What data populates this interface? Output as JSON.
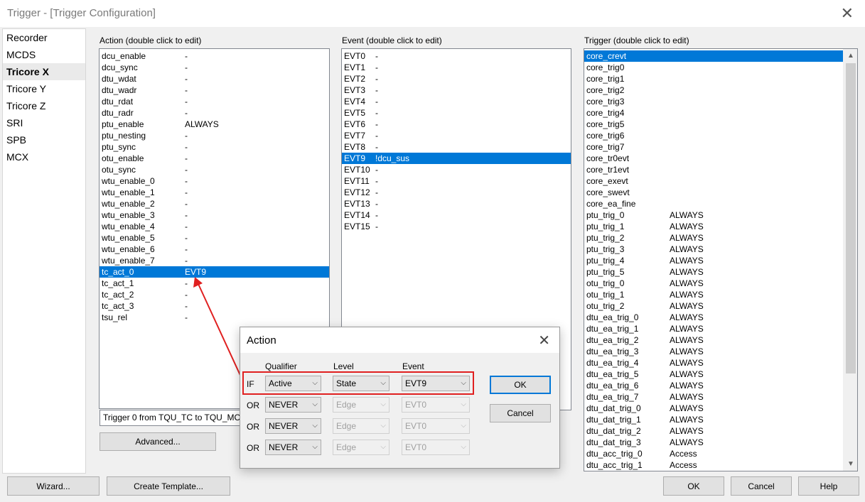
{
  "window": {
    "title": "Trigger - [Trigger Configuration]"
  },
  "sidebar": {
    "items": [
      {
        "label": "Recorder",
        "selected": false
      },
      {
        "label": "MCDS",
        "selected": false
      },
      {
        "label": "Tricore X",
        "selected": true
      },
      {
        "label": "Tricore Y",
        "selected": false
      },
      {
        "label": "Tricore Z",
        "selected": false
      },
      {
        "label": "SRI",
        "selected": false
      },
      {
        "label": "SPB",
        "selected": false
      },
      {
        "label": "MCX",
        "selected": false
      }
    ]
  },
  "action_panel": {
    "label": "Action (double click to edit)",
    "rows": [
      {
        "name": "dcu_enable",
        "value": "-"
      },
      {
        "name": "dcu_sync",
        "value": "-"
      },
      {
        "name": "dtu_wdat",
        "value": "-"
      },
      {
        "name": "dtu_wadr",
        "value": "-"
      },
      {
        "name": "dtu_rdat",
        "value": "-"
      },
      {
        "name": "dtu_radr",
        "value": "-"
      },
      {
        "name": "ptu_enable",
        "value": "ALWAYS"
      },
      {
        "name": "ptu_nesting",
        "value": "-"
      },
      {
        "name": "ptu_sync",
        "value": "-"
      },
      {
        "name": "otu_enable",
        "value": "-"
      },
      {
        "name": "otu_sync",
        "value": "-"
      },
      {
        "name": "wtu_enable_0",
        "value": "-"
      },
      {
        "name": "wtu_enable_1",
        "value": "-"
      },
      {
        "name": "wtu_enable_2",
        "value": "-"
      },
      {
        "name": "wtu_enable_3",
        "value": "-"
      },
      {
        "name": "wtu_enable_4",
        "value": "-"
      },
      {
        "name": "wtu_enable_5",
        "value": "-"
      },
      {
        "name": "wtu_enable_6",
        "value": "-"
      },
      {
        "name": "wtu_enable_7",
        "value": "-"
      },
      {
        "name": "tc_act_0",
        "value": "EVT9",
        "selected": true
      },
      {
        "name": "tc_act_1",
        "value": "-"
      },
      {
        "name": "tc_act_2",
        "value": "-"
      },
      {
        "name": "tc_act_3",
        "value": "-"
      },
      {
        "name": "tsu_rel",
        "value": "-"
      }
    ],
    "status_text": "Trigger 0 from TQU_TC to TQU_MCDS",
    "advanced_label": "Advanced..."
  },
  "event_panel": {
    "label": "Event  (double click to edit)",
    "rows": [
      {
        "name": "EVT0",
        "value": "-"
      },
      {
        "name": "EVT1",
        "value": "-"
      },
      {
        "name": "EVT2",
        "value": "-"
      },
      {
        "name": "EVT3",
        "value": "-"
      },
      {
        "name": "EVT4",
        "value": "-"
      },
      {
        "name": "EVT5",
        "value": "-"
      },
      {
        "name": "EVT6",
        "value": "-"
      },
      {
        "name": "EVT7",
        "value": "-"
      },
      {
        "name": "EVT8",
        "value": "-"
      },
      {
        "name": "EVT9",
        "value": "!dcu_sus",
        "selected": true
      },
      {
        "name": "EVT10",
        "value": "-"
      },
      {
        "name": "EVT11",
        "value": "-"
      },
      {
        "name": "EVT12",
        "value": "-"
      },
      {
        "name": "EVT13",
        "value": "-"
      },
      {
        "name": "EVT14",
        "value": "-"
      },
      {
        "name": "EVT15",
        "value": "-"
      }
    ]
  },
  "trigger_panel": {
    "label": "Trigger (double click to edit)",
    "rows": [
      {
        "name": "core_crevt",
        "value": "",
        "selected": true
      },
      {
        "name": "core_trig0",
        "value": ""
      },
      {
        "name": "core_trig1",
        "value": ""
      },
      {
        "name": "core_trig2",
        "value": ""
      },
      {
        "name": "core_trig3",
        "value": ""
      },
      {
        "name": "core_trig4",
        "value": ""
      },
      {
        "name": "core_trig5",
        "value": ""
      },
      {
        "name": "core_trig6",
        "value": ""
      },
      {
        "name": "core_trig7",
        "value": ""
      },
      {
        "name": "core_tr0evt",
        "value": ""
      },
      {
        "name": "core_tr1evt",
        "value": ""
      },
      {
        "name": "core_exevt",
        "value": ""
      },
      {
        "name": "core_swevt",
        "value": ""
      },
      {
        "name": "core_ea_fine",
        "value": ""
      },
      {
        "name": "ptu_trig_0",
        "value": "ALWAYS"
      },
      {
        "name": "ptu_trig_1",
        "value": "ALWAYS"
      },
      {
        "name": "ptu_trig_2",
        "value": "ALWAYS"
      },
      {
        "name": "ptu_trig_3",
        "value": "ALWAYS"
      },
      {
        "name": "ptu_trig_4",
        "value": "ALWAYS"
      },
      {
        "name": "ptu_trig_5",
        "value": "ALWAYS"
      },
      {
        "name": "otu_trig_0",
        "value": "ALWAYS"
      },
      {
        "name": "otu_trig_1",
        "value": "ALWAYS"
      },
      {
        "name": "otu_trig_2",
        "value": "ALWAYS"
      },
      {
        "name": "dtu_ea_trig_0",
        "value": "ALWAYS"
      },
      {
        "name": "dtu_ea_trig_1",
        "value": "ALWAYS"
      },
      {
        "name": "dtu_ea_trig_2",
        "value": "ALWAYS"
      },
      {
        "name": "dtu_ea_trig_3",
        "value": "ALWAYS"
      },
      {
        "name": "dtu_ea_trig_4",
        "value": "ALWAYS"
      },
      {
        "name": "dtu_ea_trig_5",
        "value": "ALWAYS"
      },
      {
        "name": "dtu_ea_trig_6",
        "value": "ALWAYS"
      },
      {
        "name": "dtu_ea_trig_7",
        "value": "ALWAYS"
      },
      {
        "name": "dtu_dat_trig_0",
        "value": "ALWAYS"
      },
      {
        "name": "dtu_dat_trig_1",
        "value": "ALWAYS"
      },
      {
        "name": "dtu_dat_trig_2",
        "value": "ALWAYS"
      },
      {
        "name": "dtu_dat_trig_3",
        "value": "ALWAYS"
      },
      {
        "name": "dtu_acc_trig_0",
        "value": "Access"
      },
      {
        "name": "dtu_acc_trig_1",
        "value": "Access"
      }
    ]
  },
  "bottom_buttons": {
    "wizard": "Wizard...",
    "create_template": "Create Template...",
    "ok": "OK",
    "cancel": "Cancel",
    "help": "Help"
  },
  "action_dialog": {
    "title": "Action",
    "headers": {
      "qualifier": "Qualifier",
      "level": "Level",
      "event": "Event"
    },
    "rows": [
      {
        "cond": "IF",
        "qualifier": "Active",
        "level": "State",
        "event": "EVT9",
        "enabled": true
      },
      {
        "cond": "OR",
        "qualifier": "NEVER",
        "level": "Edge",
        "event": "EVT0",
        "enabled": false
      },
      {
        "cond": "OR",
        "qualifier": "NEVER",
        "level": "Edge",
        "event": "EVT0",
        "enabled": false
      },
      {
        "cond": "OR",
        "qualifier": "NEVER",
        "level": "Edge",
        "event": "EVT0",
        "enabled": false
      }
    ],
    "ok_label": "OK",
    "cancel_label": "Cancel"
  },
  "colors": {
    "selection": "#0078d7",
    "annotation": "#e02020"
  }
}
